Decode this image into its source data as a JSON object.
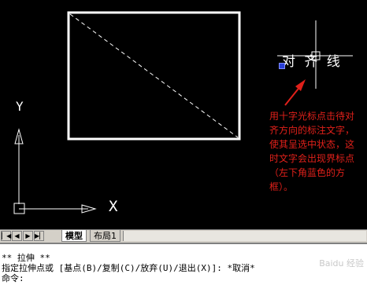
{
  "drawing": {
    "text_label": "对 齐 线",
    "ucs_x": "X",
    "ucs_y": "Y"
  },
  "annotation": {
    "text": "用十字光标点击待对齐方向的标注文字，使其呈选中状态，这时文字会出现界标点（左下角蓝色的方框）。",
    "color": "#e0201a"
  },
  "tabs": {
    "nav_first": "▏◀",
    "nav_prev": "◀",
    "nav_next": "▶",
    "nav_last": "▶▏",
    "model": "模型",
    "layout1": "布局1"
  },
  "command": {
    "line1": "** 拉伸 **",
    "line2": "指定拉伸点或 [基点(B)/复制(C)/放弃(U)/退出(X)]: *取消*",
    "line3": "命令:"
  },
  "watermark": "Baidu 经验"
}
